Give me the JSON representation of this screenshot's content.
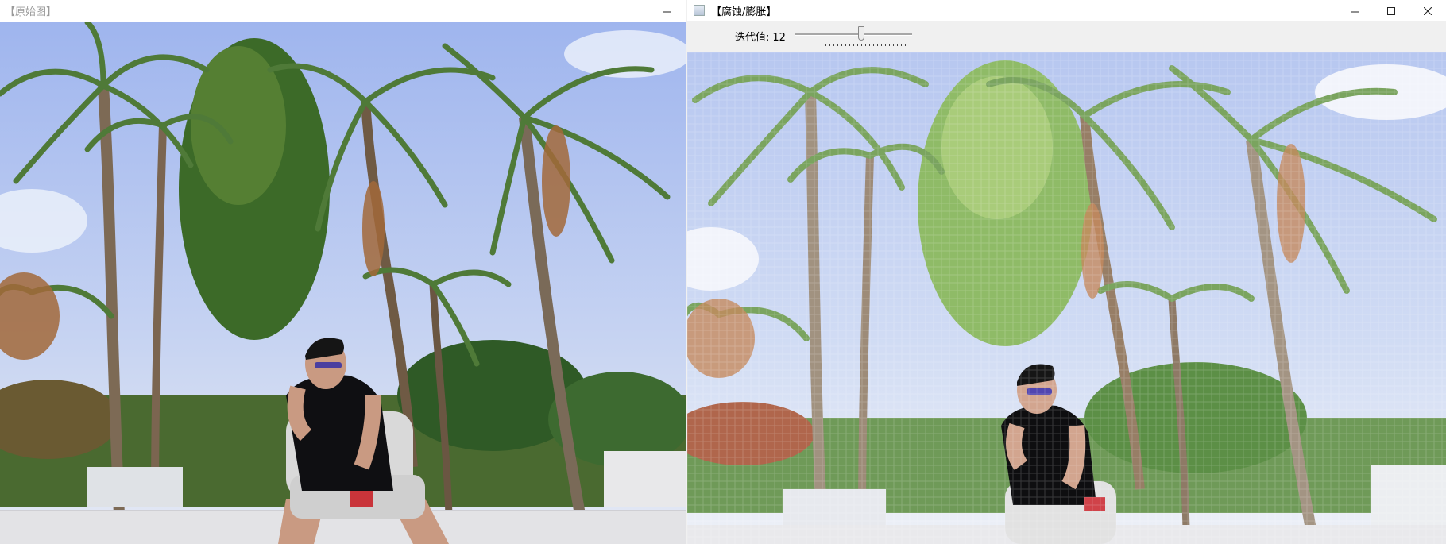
{
  "left_window": {
    "title": "【原始图】",
    "controls": {
      "minimize": "–"
    }
  },
  "right_window": {
    "title": "【腐蚀/膨胀】",
    "controls": {
      "minimize": "–",
      "maximize": "□",
      "close": "✕"
    },
    "trackbar": {
      "label": "迭代值:",
      "value": "12",
      "level_fraction": 0.57
    }
  },
  "image_colors": {
    "sky": "#b9c9ef",
    "foliage": "#3f6a2c",
    "trunk": "#7a5d3f",
    "wall": "#e7e7ea"
  }
}
